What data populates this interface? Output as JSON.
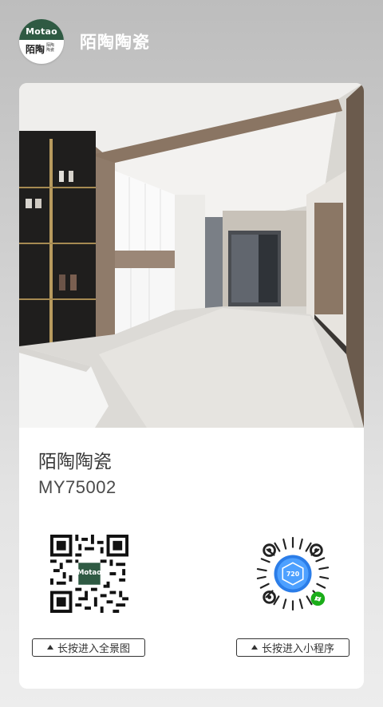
{
  "header": {
    "logo_mark": "Motao",
    "logo_cn": "陌陶",
    "logo_small": "陌陶\n陶瓷",
    "brand": "陌陶陶瓷"
  },
  "card": {
    "title": "陌陶陶瓷",
    "model": "MY75002",
    "panorama_button": "长按进入全景图",
    "miniprogram_button": "长按进入小程序",
    "mini_code_label": "720",
    "qr_logo_text": "Motao"
  },
  "colors": {
    "brand_green": "#2f5a43",
    "miniprogram_blue": "#2b7de8",
    "wechat_green": "#1aad19"
  },
  "icons": {
    "button_icon": "triangle-up-icon",
    "link_badge": "link-icon"
  }
}
